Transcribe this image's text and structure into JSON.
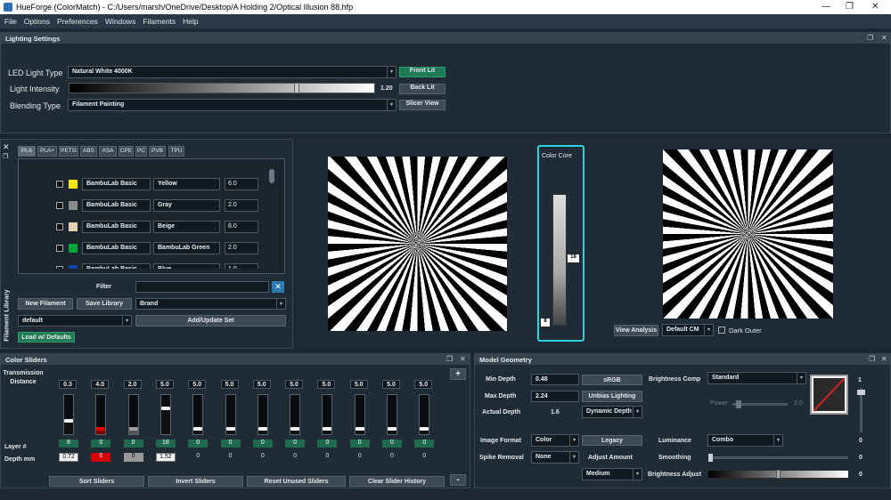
{
  "window": {
    "title": "HueForge (ColorMatch) - C:/Users/marsh/OneDrive/Desktop/A Holding 2/Optical Illusion 88.hfp"
  },
  "menu": [
    "File",
    "Options",
    "Preferences",
    "Windows",
    "Filaments",
    "Help"
  ],
  "lighting": {
    "header": "Lighting Settings",
    "led_label": "LED Light Type",
    "led_value": "Natural White 4000K",
    "intensity_label": "Light Intensity",
    "intensity_value": "1.20",
    "intensity_fraction": 0.75,
    "blending_label": "Blending Type",
    "blending_value": "Filament Painting",
    "front_lit": "Front Lit",
    "back_lit": "Back Lit",
    "slicer_view": "Slicer View"
  },
  "filament_library": {
    "side_label": "Filament Library",
    "tabs": [
      "PLA",
      "PLA+",
      "PETG",
      "ABS",
      "ASA",
      "CPE",
      "PC",
      "PVB",
      "TPU"
    ],
    "rows": [
      {
        "brand": "BambuLab Basic",
        "name": "Yellow",
        "td": "6.0",
        "color": "#f2e600"
      },
      {
        "brand": "BambuLab Basic",
        "name": "Gray",
        "td": "2.0",
        "color": "#8b8b8b"
      },
      {
        "brand": "BambuLab Basic",
        "name": "Beige",
        "td": "8.0",
        "color": "#e4d2b2"
      },
      {
        "brand": "BambuLab Basic",
        "name": "BambuLab Green",
        "td": "2.0",
        "color": "#00a63c"
      },
      {
        "brand": "BambuLab Basic",
        "name": "Blue",
        "td": "1.0",
        "color": "#1144a8"
      }
    ],
    "filter_label": "Filter",
    "new_filament": "New Filament",
    "save_library": "Save Library",
    "brand_value": "Brand",
    "set_value": "default",
    "add_update_set": "Add/Update Set",
    "load_defaults": "Load w/ Defaults"
  },
  "color_core": {
    "label": "Color Core",
    "top_value": "18",
    "bottom_value": "8"
  },
  "preview": {
    "view_analysis": "View Analysis",
    "cm_value": "Default CM",
    "dark_outer": "Dark Outer"
  },
  "color_sliders": {
    "header": "Color Sliders",
    "transmission_label": "Transmission Distance",
    "layer_label": "Layer #",
    "depth_label": "Depth mm",
    "sliders": [
      {
        "td": "0.3",
        "layer": "8",
        "depth": "0.72",
        "knob_color": "#f0f0f0",
        "fill_color": "#101010",
        "fill": 0.3,
        "depth_style": "white"
      },
      {
        "td": "4.0",
        "layer": "0",
        "depth": "0",
        "knob_color": "#e00000",
        "fill_color": "#7a0000",
        "fill": 0.08,
        "depth_style": "red"
      },
      {
        "td": "2.0",
        "layer": "0",
        "depth": "0",
        "knob_color": "#9a9a9a",
        "fill_color": "#555",
        "fill": 0.08,
        "depth_style": "gray"
      },
      {
        "td": "5.0",
        "layer": "18",
        "depth": "1.52",
        "knob_color": "#f0f0f0",
        "fill_color": "#101010",
        "fill": 0.62,
        "depth_style": "white"
      },
      {
        "td": "5.0",
        "layer": "0",
        "depth": "0",
        "knob_color": "#f0f0f0",
        "fill_color": "#101010",
        "fill": 0.08,
        "depth_style": "plain"
      },
      {
        "td": "5.0",
        "layer": "0",
        "depth": "0",
        "knob_color": "#f0f0f0",
        "fill_color": "#101010",
        "fill": 0.08,
        "depth_style": "plain"
      },
      {
        "td": "5.0",
        "layer": "0",
        "depth": "0",
        "knob_color": "#f0f0f0",
        "fill_color": "#101010",
        "fill": 0.08,
        "depth_style": "plain"
      },
      {
        "td": "5.0",
        "layer": "0",
        "depth": "0",
        "knob_color": "#f0f0f0",
        "fill_color": "#101010",
        "fill": 0.08,
        "depth_style": "plain"
      },
      {
        "td": "5.0",
        "layer": "0",
        "depth": "0",
        "knob_color": "#f0f0f0",
        "fill_color": "#101010",
        "fill": 0.08,
        "depth_style": "plain"
      },
      {
        "td": "5.0",
        "layer": "0",
        "depth": "0",
        "knob_color": "#f0f0f0",
        "fill_color": "#101010",
        "fill": 0.08,
        "depth_style": "plain"
      },
      {
        "td": "5.0",
        "layer": "0",
        "depth": "0",
        "knob_color": "#f0f0f0",
        "fill_color": "#101010",
        "fill": 0.08,
        "depth_style": "plain"
      },
      {
        "td": "5.0",
        "layer": "0",
        "depth": "0",
        "knob_color": "#f0f0f0",
        "fill_color": "#101010",
        "fill": 0.08,
        "depth_style": "plain"
      }
    ],
    "sort": "Sort Sliders",
    "invert": "Invert Sliders",
    "reset": "Reset Unused Sliders",
    "clear": "Clear Slider History",
    "add": "+",
    "remove": "-"
  },
  "model_geometry": {
    "header": "Model Geometry",
    "min_depth_label": "Min Depth",
    "min_depth": "0.48",
    "max_depth_label": "Max Depth",
    "max_depth": "2.24",
    "actual_depth_label": "Actual Depth",
    "actual_depth": "1.6",
    "srgb": "sRGB",
    "unbias": "Unbias Lighting",
    "dynamic_depth": "Dynamic Depth",
    "brightness_comp_label": "Brightness Comp",
    "brightness_comp": "Standard",
    "power_label": "Power",
    "power_value": "2.0",
    "image_format_label": "Image Format",
    "image_format": "Color",
    "legacy": "Legacy",
    "luminance_label": "Luminance",
    "luminance": "Combo",
    "spike_removal_label": "Spike Removal",
    "spike_removal": "None",
    "adjust_amount_label": "Adjust Amount",
    "adjust_amount": "Medium",
    "smoothing_label": "Smoothing",
    "smoothing_value": "0",
    "brightness_adjust_label": "Brightness Adjust",
    "brightness_adjust_value": "0",
    "vslider_top": "1",
    "vslider_bottom": "0"
  }
}
